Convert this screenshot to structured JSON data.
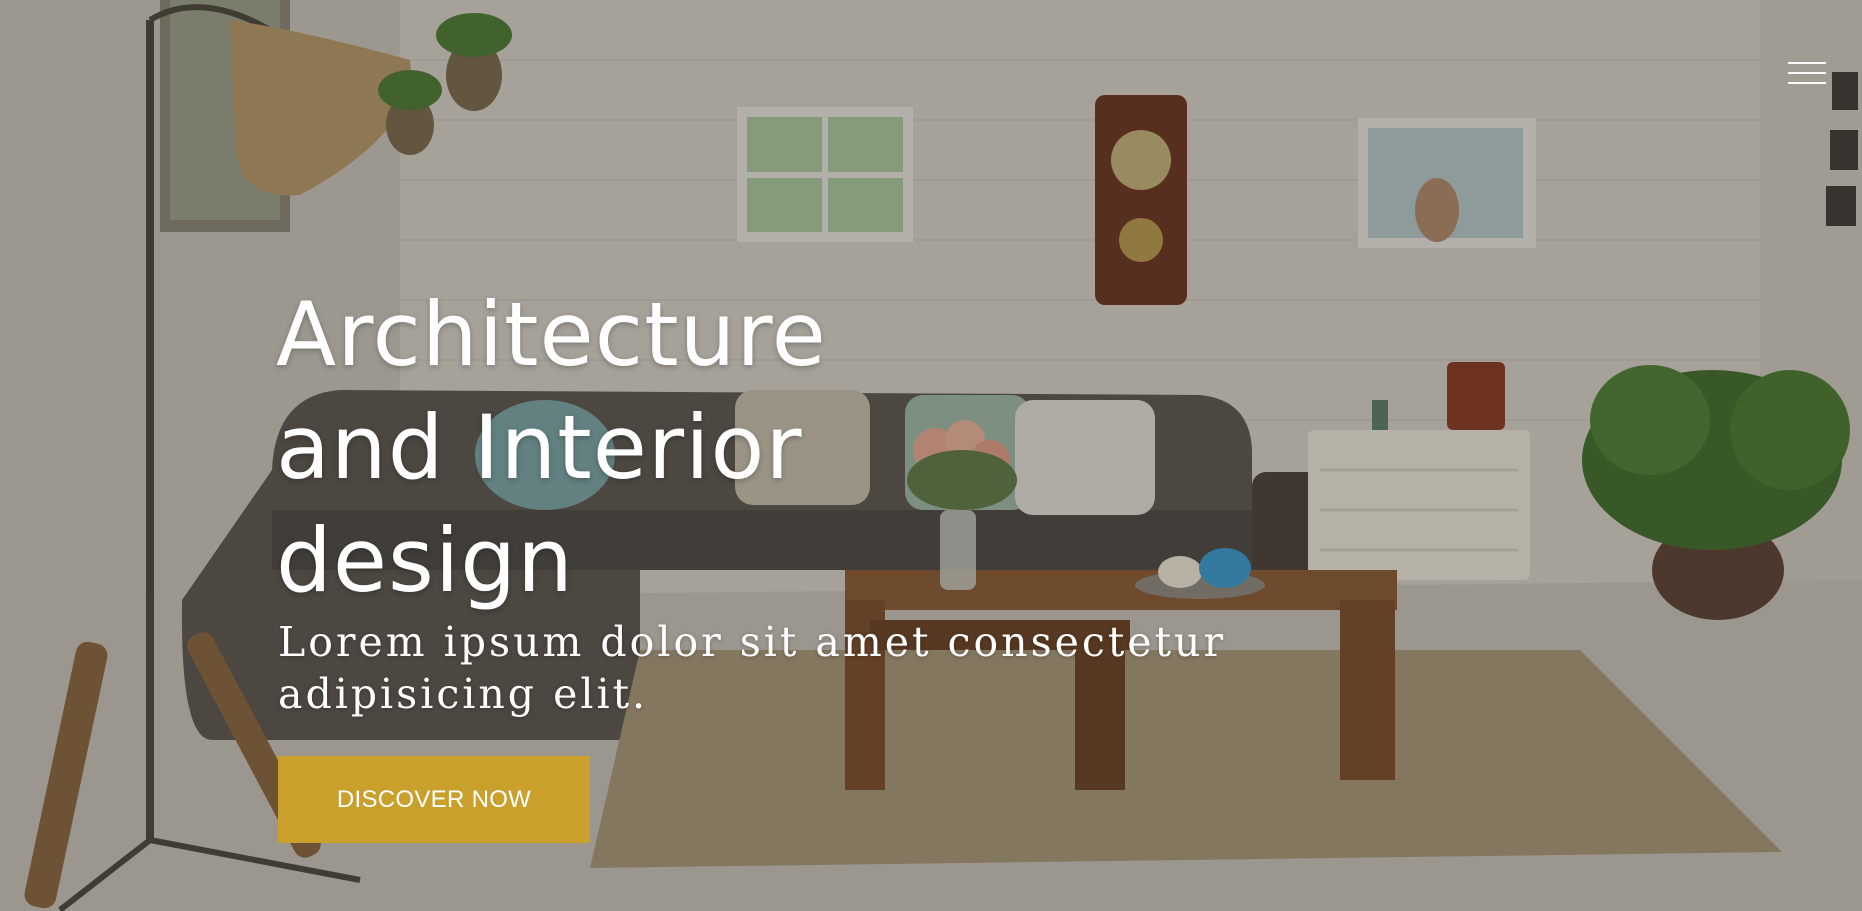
{
  "hero": {
    "headline_lines": [
      "Architecture",
      "and Interior",
      "design"
    ],
    "tagline_lines": [
      "Lorem ipsum dolor sit amet consectetur",
      "adipisicing elit."
    ],
    "cta_label": "DISCOVER NOW"
  },
  "nav": {
    "menu_icon": "hamburger-menu-icon"
  },
  "colors": {
    "accent": "#c9a02c",
    "text": "#ffffff",
    "wall": "#d7d3cb",
    "sofa": "#5a5550",
    "table": "#8a5a32",
    "rug": "#a8977a",
    "floor": "#c8c4bc"
  }
}
